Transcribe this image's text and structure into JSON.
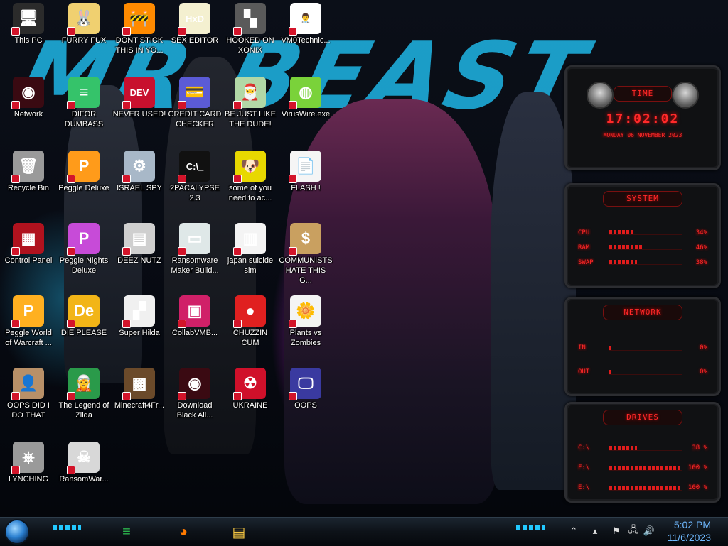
{
  "wallpaper": {
    "text": "MR BEAST"
  },
  "icons": [
    {
      "label": "This PC",
      "glyph": "🖥",
      "bg": "#2b2b2b"
    },
    {
      "label": "FURRY FUX",
      "glyph": "🐰",
      "bg": "#f0d070"
    },
    {
      "label": "DONT STICK THIS IN YO...",
      "glyph": "🚧",
      "bg": "#ff8a00"
    },
    {
      "label": "SEX EDITOR",
      "glyph": "HxD",
      "bg": "#f4f0d0"
    },
    {
      "label": "HOOKED ON XONIX",
      "glyph": "▚",
      "bg": "#5a5a5a"
    },
    {
      "label": "VM0Technic...",
      "glyph": "👨‍⚕️",
      "bg": "#ffffff"
    },
    {
      "label": "Network",
      "glyph": "◉",
      "bg": "#3a0a12"
    },
    {
      "label": "DIFOR DUMBASS",
      "glyph": "≡",
      "bg": "#35c36a"
    },
    {
      "label": "NEVER USED!",
      "glyph": "DEV",
      "bg": "#c8102e"
    },
    {
      "label": "CREDIT CARD CHECKER",
      "glyph": "💳",
      "bg": "#5b5bd6"
    },
    {
      "label": "BE JUST LIKE THE DUDE!",
      "glyph": "🎅",
      "bg": "#b2d8a6"
    },
    {
      "label": "VirusWire.exe",
      "glyph": "◍",
      "bg": "#7ad23a"
    },
    {
      "label": "Recycle Bin",
      "glyph": "🗑",
      "bg": "#9a9a9a"
    },
    {
      "label": "Peggle Deluxe",
      "glyph": "P",
      "bg": "#ff9b1a"
    },
    {
      "label": "ISRAEL SPY",
      "glyph": "⚙",
      "bg": "#a8b8c8"
    },
    {
      "label": "2PACALYPSE 2.3",
      "glyph": "C:\\_",
      "bg": "#111111"
    },
    {
      "label": "some of you need to ac...",
      "glyph": "🐶",
      "bg": "#e8d800"
    },
    {
      "label": "FLASH !",
      "glyph": "📄",
      "bg": "#f5f5f5"
    },
    {
      "label": "Control Panel",
      "glyph": "▦",
      "bg": "#b0121e"
    },
    {
      "label": "Peggle Nights Deluxe",
      "glyph": "P",
      "bg": "#c74bd8"
    },
    {
      "label": "DEEZ NUTZ",
      "glyph": "▤",
      "bg": "#cfcfcf"
    },
    {
      "label": "Ransomware Maker Build...",
      "glyph": "▭",
      "bg": "#dfe8e8"
    },
    {
      "label": "japan suicide sim",
      "glyph": "▥",
      "bg": "#f4f4f4"
    },
    {
      "label": "COMMUNISTS HATE THIS G...",
      "glyph": "$",
      "bg": "#c9a060"
    },
    {
      "label": "Peggle World of Warcraft ...",
      "glyph": "P",
      "bg": "#ffb020"
    },
    {
      "label": "DIE PLEASE",
      "glyph": "De",
      "bg": "#f2b517"
    },
    {
      "label": "Super Hilda",
      "glyph": "▞",
      "bg": "#f0f0f0"
    },
    {
      "label": "CollabVMB...",
      "glyph": "▣",
      "bg": "#d02068"
    },
    {
      "label": "CHUZZIN CUM",
      "glyph": "●",
      "bg": "#e02020"
    },
    {
      "label": "Plants vs Zombies",
      "glyph": "🌼",
      "bg": "#f4f4f4"
    },
    {
      "label": "OOPS DID I DO THAT",
      "glyph": "👤",
      "bg": "#b89068"
    },
    {
      "label": "The Legend of Zilda",
      "glyph": "🧝",
      "bg": "#2a9a4a"
    },
    {
      "label": "Minecraft4Fr...",
      "glyph": "▩",
      "bg": "#6b4a2a"
    },
    {
      "label": "Download Black Ali...",
      "glyph": "◉",
      "bg": "#3a0a12"
    },
    {
      "label": "UKRAINE",
      "glyph": "☢",
      "bg": "#d0102a"
    },
    {
      "label": "OOPS",
      "glyph": "🖵",
      "bg": "#3a3aa0"
    },
    {
      "label": "LYNCHING",
      "glyph": "⎈",
      "bg": "#9a9a9a"
    },
    {
      "label": "RansomWar...",
      "glyph": "☠",
      "bg": "#d8d8d8"
    }
  ],
  "gadget": {
    "time": {
      "title": "TIME",
      "clock": "17:02:02",
      "date": "MONDAY 06 NOVEMBER 2023"
    },
    "system": {
      "title": "SYSTEM",
      "rows": [
        {
          "key": "CPU",
          "value": "34%",
          "level": 0.34
        },
        {
          "key": "RAM",
          "value": "46%",
          "level": 0.46
        },
        {
          "key": "SWAP",
          "value": "38%",
          "level": 0.38
        }
      ]
    },
    "network": {
      "title": "NETWORK",
      "rows": [
        {
          "key": "IN",
          "value": "0%",
          "level": 0.0
        },
        {
          "key": "OUT",
          "value": "0%",
          "level": 0.0
        }
      ]
    },
    "drives": {
      "title": "DRIVES",
      "rows": [
        {
          "key": "C:\\",
          "value": "38 %",
          "level": 0.38
        },
        {
          "key": "F:\\",
          "value": "100 %",
          "level": 1.0
        },
        {
          "key": "E:\\",
          "value": "100 %",
          "level": 1.0
        }
      ]
    }
  },
  "taskbar": {
    "apps": [
      {
        "name": "feedly",
        "glyph": "≡",
        "color": "#2bb24c"
      },
      {
        "name": "firefox",
        "glyph": "◕",
        "color": "#ff7a00"
      },
      {
        "name": "explorer",
        "glyph": "▤",
        "color": "#f4c542"
      }
    ],
    "tray": [
      {
        "name": "up-arrow",
        "glyph": "⌃"
      },
      {
        "name": "app-tray",
        "glyph": "▴"
      },
      {
        "name": "security",
        "glyph": "⚑"
      },
      {
        "name": "network",
        "glyph": "🖧"
      },
      {
        "name": "volume",
        "glyph": "🔊"
      }
    ],
    "clock": {
      "time": "5:02 PM",
      "date": "11/6/2023"
    }
  }
}
